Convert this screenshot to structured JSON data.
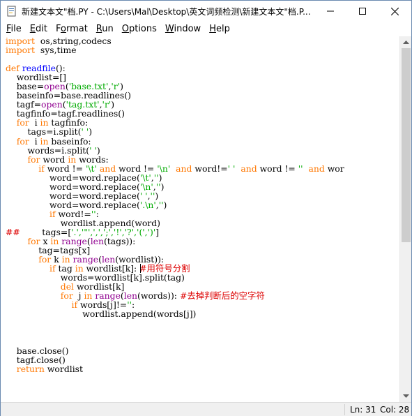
{
  "window": {
    "title": "新建文本文\"档.PY - C:\\Users\\Mal\\Desktop\\英文词频检测\\新建文本文\"档.P..."
  },
  "menu": [
    {
      "key": "F",
      "rest": "ile"
    },
    {
      "key": "E",
      "rest": "dit"
    },
    {
      "key": "",
      "pre": "F",
      "keyu": "o",
      "rest": "rmat"
    },
    {
      "key": "R",
      "rest": "un"
    },
    {
      "key": "O",
      "rest": "ptions"
    },
    {
      "key": "W",
      "rest": "indow"
    },
    {
      "key": "H",
      "rest": "elp"
    }
  ],
  "code_lines": [
    [
      [
        "kw",
        "import"
      ],
      [
        "",
        "  os,string,codecs"
      ]
    ],
    [
      [
        "kw",
        "import"
      ],
      [
        "",
        "  sys,time"
      ]
    ],
    [
      [
        "",
        ""
      ]
    ],
    [
      [
        "kw",
        "def"
      ],
      [
        "",
        " "
      ],
      [
        "def",
        "readfile"
      ],
      [
        "",
        "():"
      ]
    ],
    [
      [
        "",
        "    wordlist=[]"
      ]
    ],
    [
      [
        "",
        "    base="
      ],
      [
        "bi",
        "open"
      ],
      [
        "",
        "("
      ],
      [
        "str",
        "'base.txt'"
      ],
      [
        "",
        ","
      ],
      [
        "str",
        "'r'"
      ],
      [
        "",
        ")"
      ]
    ],
    [
      [
        "",
        "    baseinfo=base.readlines()"
      ]
    ],
    [
      [
        "",
        "    tagf="
      ],
      [
        "bi",
        "open"
      ],
      [
        "",
        "("
      ],
      [
        "str",
        "'tag.txt'"
      ],
      [
        "",
        ","
      ],
      [
        "str",
        "'r'"
      ],
      [
        "",
        ")"
      ]
    ],
    [
      [
        "",
        "    tagfinfo=tagf.readlines()"
      ]
    ],
    [
      [
        "",
        "    "
      ],
      [
        "kw",
        "for"
      ],
      [
        "",
        ""
      ],
      [
        "",
        "  i "
      ],
      [
        "kw",
        "in"
      ],
      [
        "",
        " tagfinfo:"
      ]
    ],
    [
      [
        "",
        "        tags=i.split("
      ],
      [
        "str",
        "' '"
      ],
      [
        "",
        ")"
      ]
    ],
    [
      [
        "",
        "    "
      ],
      [
        "kw",
        "for"
      ],
      [
        "",
        "  i "
      ],
      [
        "kw",
        "in"
      ],
      [
        "",
        " baseinfo:"
      ]
    ],
    [
      [
        "",
        "        words=i.split("
      ],
      [
        "str",
        "' '"
      ],
      [
        "",
        ")"
      ]
    ],
    [
      [
        "",
        "        "
      ],
      [
        "kw",
        "for"
      ],
      [
        "",
        " word "
      ],
      [
        "kw",
        "in"
      ],
      [
        "",
        " words:"
      ]
    ],
    [
      [
        "",
        "            "
      ],
      [
        "kw",
        "if"
      ],
      [
        "",
        " word != "
      ],
      [
        "str",
        "'\\t'"
      ],
      [
        "kw",
        " and"
      ],
      [
        "",
        " word != "
      ],
      [
        "str",
        "'\\n'"
      ],
      [
        "",
        "  "
      ],
      [
        "kw",
        "and"
      ],
      [
        "",
        " word!="
      ],
      [
        "str",
        "' '"
      ],
      [
        "",
        "  "
      ],
      [
        "kw",
        "and"
      ],
      [
        "",
        " word != "
      ],
      [
        "str",
        "''"
      ],
      [
        "",
        "  "
      ],
      [
        "kw",
        "and"
      ],
      [
        "",
        " wor"
      ]
    ],
    [
      [
        "",
        "                word=word.replace("
      ],
      [
        "str",
        "'\\t'"
      ],
      [
        "",
        ","
      ],
      [
        "str",
        "''"
      ],
      [
        "",
        ")"
      ]
    ],
    [
      [
        "",
        "                word=word.replace("
      ],
      [
        "str",
        "'\\n'"
      ],
      [
        "",
        ","
      ],
      [
        "str",
        "''"
      ],
      [
        "",
        ")"
      ]
    ],
    [
      [
        "",
        "                word=word.replace("
      ],
      [
        "str",
        "' '"
      ],
      [
        "",
        ","
      ],
      [
        "str",
        "''"
      ],
      [
        "",
        ")"
      ]
    ],
    [
      [
        "",
        "                word=word.replace("
      ],
      [
        "str",
        "'.\\n'"
      ],
      [
        "",
        ","
      ],
      [
        "str",
        "''"
      ],
      [
        "",
        ")"
      ]
    ],
    [
      [
        "",
        "                "
      ],
      [
        "kw",
        "if"
      ],
      [
        "",
        " word!="
      ],
      [
        "str",
        "''"
      ],
      [
        "",
        ":"
      ]
    ],
    [
      [
        "",
        "                    wordlist.append(word)"
      ]
    ],
    [
      [
        "cm",
        "##"
      ],
      [
        "",
        "        tags=["
      ],
      [
        "str",
        "'.','\"',',',';','!','?','(',')'"
      ],
      [
        "",
        "]"
      ]
    ],
    [
      [
        "",
        "        "
      ],
      [
        "kw",
        "for"
      ],
      [
        "",
        " x "
      ],
      [
        "kw",
        "in"
      ],
      [
        "",
        " "
      ],
      [
        "bi",
        "range"
      ],
      [
        "",
        "("
      ],
      [
        "bi",
        "len"
      ],
      [
        "",
        "(tags)):"
      ]
    ],
    [
      [
        "",
        "            tag=tags[x]"
      ]
    ],
    [
      [
        "",
        "            "
      ],
      [
        "kw",
        "for"
      ],
      [
        "",
        " k "
      ],
      [
        "kw",
        "in"
      ],
      [
        "",
        " "
      ],
      [
        "bi",
        "range"
      ],
      [
        "",
        "("
      ],
      [
        "bi",
        "len"
      ],
      [
        "",
        "(wordlist)):"
      ]
    ],
    [
      [
        "",
        "                "
      ],
      [
        "kw",
        "if"
      ],
      [
        "",
        " tag "
      ],
      [
        "kw",
        "in"
      ],
      [
        "",
        " wordlist[k]: "
      ],
      [
        "cm",
        "#用符号分割"
      ]
    ],
    [
      [
        "",
        "                    words=wordlist[k].split(tag)"
      ]
    ],
    [
      [
        "",
        "                    "
      ],
      [
        "kw",
        "del"
      ],
      [
        "",
        " wordlist[k]"
      ]
    ],
    [
      [
        "",
        "                    "
      ],
      [
        "kw",
        "for"
      ],
      [
        "",
        "  j "
      ],
      [
        "kw",
        "in"
      ],
      [
        "",
        " "
      ],
      [
        "bi",
        "range"
      ],
      [
        "",
        "("
      ],
      [
        "bi",
        "len"
      ],
      [
        "",
        "(words)): "
      ],
      [
        "cm",
        "#去掉判断后的空字符"
      ]
    ],
    [
      [
        "",
        "                        "
      ],
      [
        "kw",
        "if"
      ],
      [
        "",
        " words[j]!="
      ],
      [
        "str",
        "''"
      ],
      [
        "",
        ":"
      ]
    ],
    [
      [
        "",
        "                            wordlist.append(words[j])"
      ]
    ],
    [
      [
        "",
        ""
      ]
    ],
    [
      [
        "",
        ""
      ]
    ],
    [
      [
        "",
        ""
      ]
    ],
    [
      [
        "",
        "    base.close()"
      ]
    ],
    [
      [
        "",
        "    tagf.close()"
      ]
    ],
    [
      [
        "",
        "    "
      ],
      [
        "kw",
        "return"
      ],
      [
        "",
        " wordlist"
      ]
    ]
  ],
  "status": {
    "line": "Ln: 31",
    "col": "Col: 28"
  },
  "icons": {
    "app": "python-idle-icon",
    "minimize": "minimize-icon",
    "maximize": "maximize-icon",
    "close": "close-icon",
    "scroll_up": "scroll-up-arrow-icon",
    "scroll_down": "scroll-down-arrow-icon"
  }
}
